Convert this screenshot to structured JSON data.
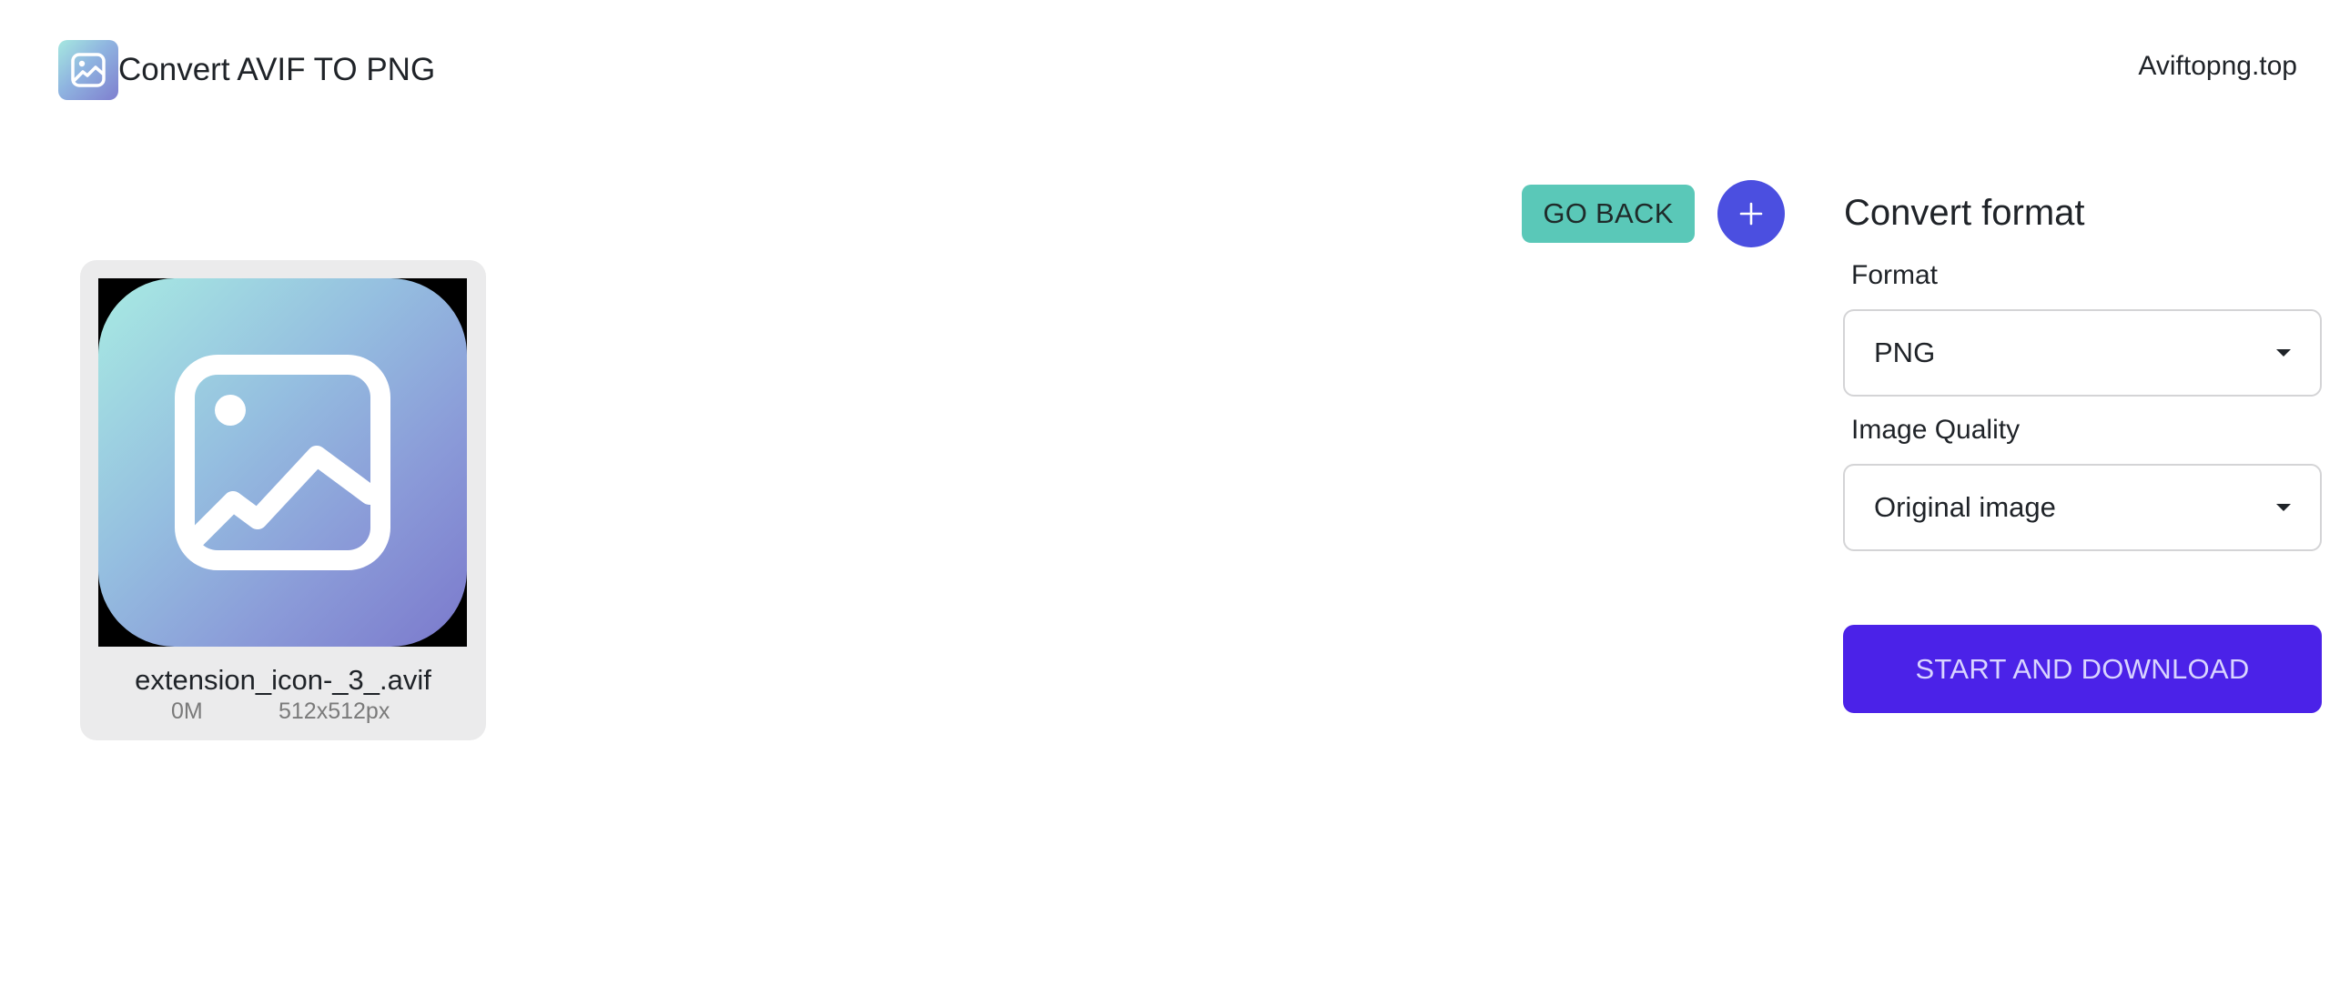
{
  "header": {
    "logo_icon": "image-icon",
    "title": "Convert AVIF TO PNG",
    "site_link": "Aviftopng.top"
  },
  "actions": {
    "go_back_label": "GO BACK",
    "add_icon": "plus-icon"
  },
  "files": [
    {
      "thumbnail_icon": "image-icon",
      "name": "extension_icon-_3_.avif",
      "size": "0M",
      "dimensions": "512x512px"
    }
  ],
  "panel": {
    "title": "Convert format",
    "format": {
      "label": "Format",
      "selected": "PNG"
    },
    "quality": {
      "label": "Image Quality",
      "selected": "Original image"
    },
    "start_label": "START AND DOWNLOAD"
  },
  "colors": {
    "go_back_bg": "#5ac8b8",
    "add_button_bg": "#4b4fe0",
    "start_button_bg": "#4b22e8",
    "card_bg": "#ebebec"
  }
}
